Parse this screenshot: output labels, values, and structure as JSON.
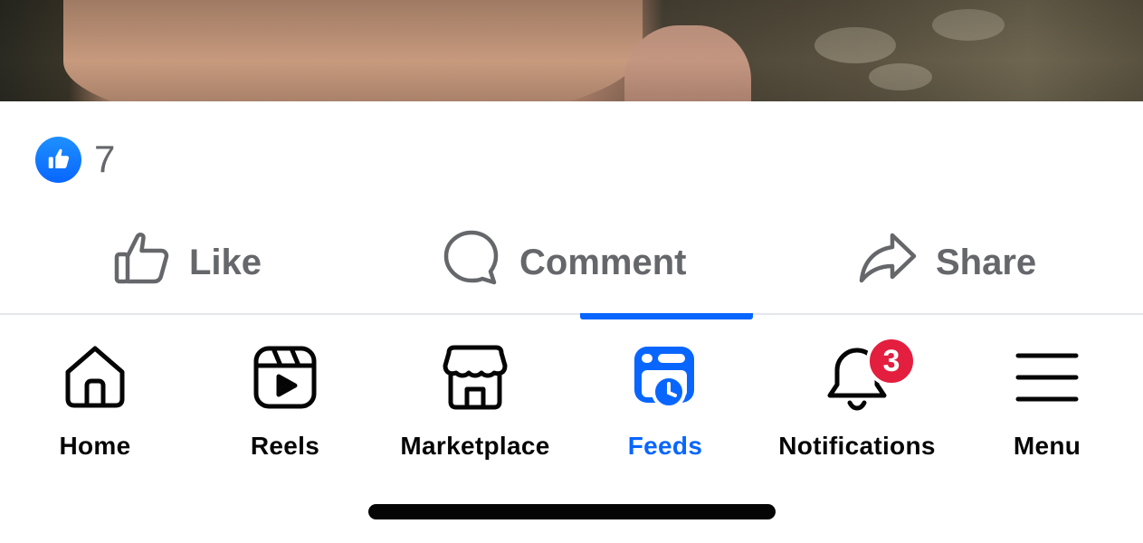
{
  "post": {
    "reactions": {
      "icon": "like-reaction-icon",
      "count": "7",
      "color": "#0866ff"
    },
    "actions": [
      {
        "label": "Like",
        "icon": "thumbs-up-icon"
      },
      {
        "label": "Comment",
        "icon": "comment-bubble-icon"
      },
      {
        "label": "Share",
        "icon": "share-arrow-icon"
      }
    ]
  },
  "tabbar": {
    "active_color": "#0866ff",
    "tabs": [
      {
        "label": "Home",
        "icon": "home-icon",
        "active": false
      },
      {
        "label": "Reels",
        "icon": "reels-icon",
        "active": false
      },
      {
        "label": "Marketplace",
        "icon": "marketplace-store-icon",
        "active": false
      },
      {
        "label": "Feeds",
        "icon": "feeds-icon",
        "active": true
      },
      {
        "label": "Notifications",
        "icon": "bell-icon",
        "active": false,
        "badge": "3"
      },
      {
        "label": "Menu",
        "icon": "hamburger-menu-icon",
        "active": false
      }
    ],
    "badge_color": "#e41e3f"
  }
}
